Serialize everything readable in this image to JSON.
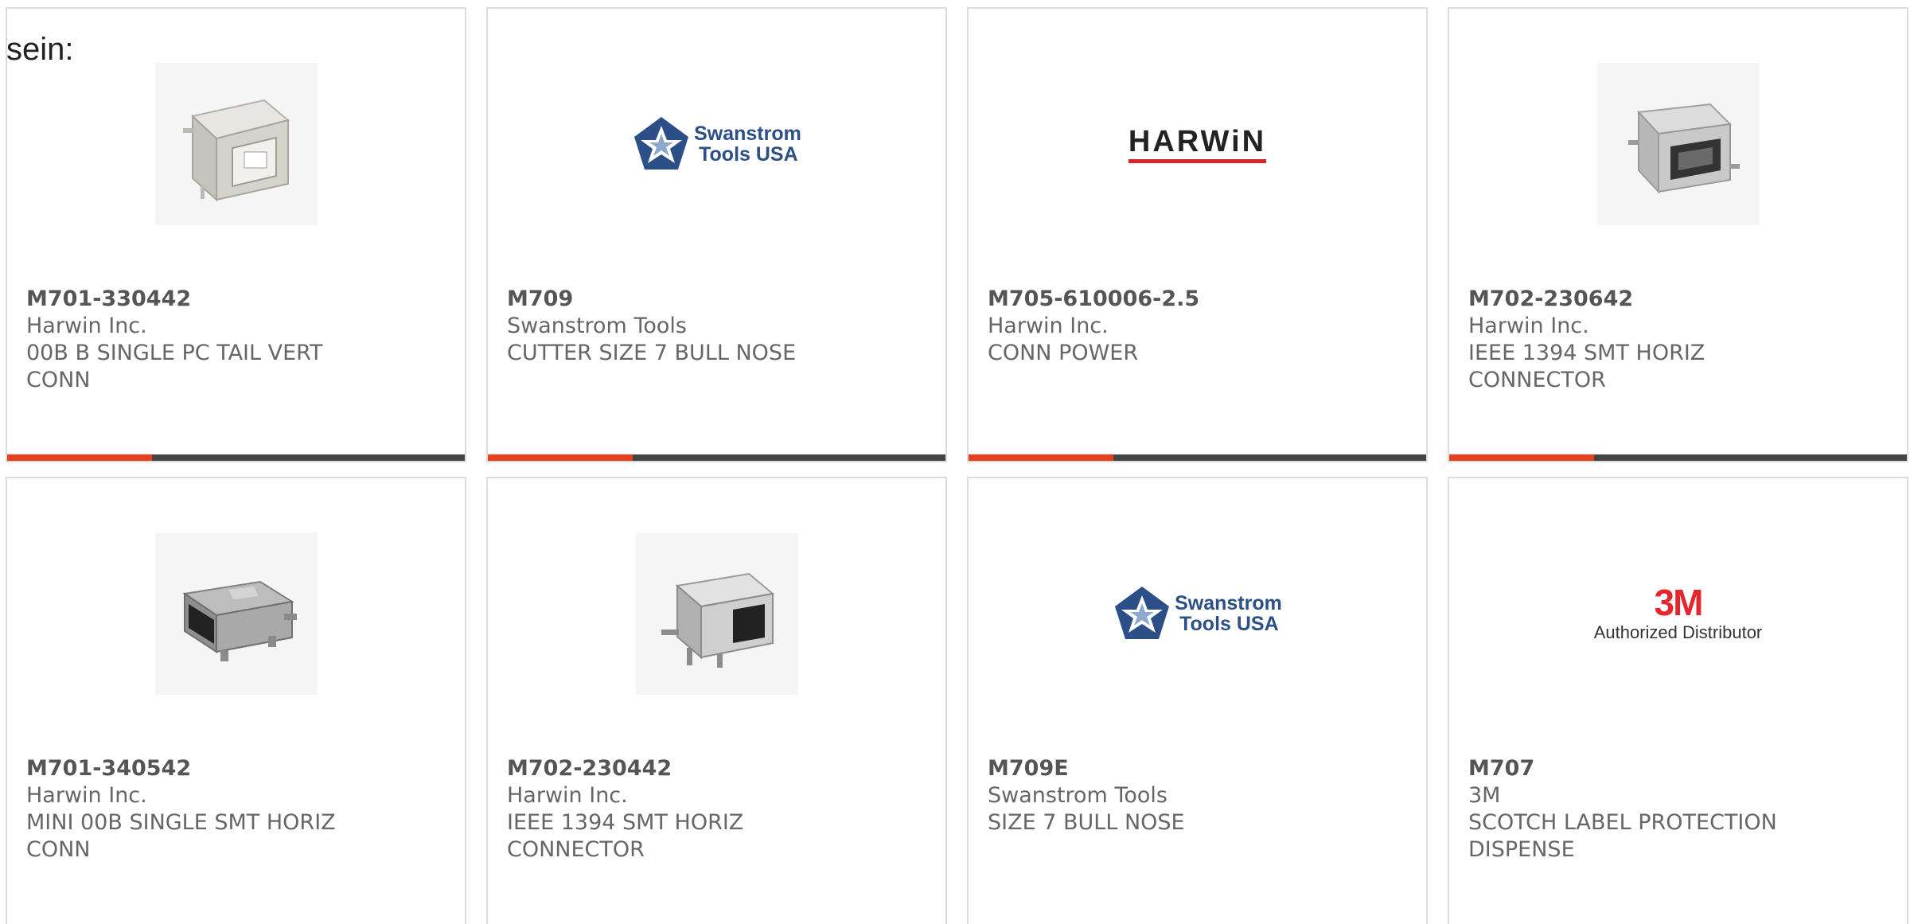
{
  "intro": {
    "text": "sein:"
  },
  "colors": {
    "accent": "#e8401c",
    "bar": "#444444",
    "text": "#666666"
  },
  "products": [
    {
      "part_number": "M701-330442",
      "manufacturer": "Harwin Inc.",
      "description_line1": "00B B SINGLE PC TAIL VERT",
      "description_line2": "CONN",
      "image": "usb-b-connector-photo"
    },
    {
      "part_number": "M709",
      "manufacturer": "Swanstrom Tools",
      "description_line1": "CUTTER SIZE 7 BULL NOSE",
      "description_line2": "",
      "image": "swanstrom-logo"
    },
    {
      "part_number": "M705-610006-2.5",
      "manufacturer": "Harwin Inc.",
      "description_line1": "CONN POWER",
      "description_line2": "",
      "image": "harwin-logo"
    },
    {
      "part_number": "M702-230642",
      "manufacturer": "Harwin Inc.",
      "description_line1": "IEEE 1394 SMT HORIZ",
      "description_line2": "CONNECTOR",
      "image": "ieee1394-connector-photo"
    },
    {
      "part_number": "M701-340542",
      "manufacturer": "Harwin Inc.",
      "description_line1": "MINI 00B SINGLE SMT HORIZ",
      "description_line2": "CONN",
      "image": "mini-usb-connector-photo"
    },
    {
      "part_number": "M702-230442",
      "manufacturer": "Harwin Inc.",
      "description_line1": "IEEE 1394 SMT HORIZ",
      "description_line2": "CONNECTOR",
      "image": "ieee1394-connector-photo"
    },
    {
      "part_number": "M709E",
      "manufacturer": "Swanstrom Tools",
      "description_line1": "SIZE 7 BULL NOSE",
      "description_line2": "",
      "image": "swanstrom-logo"
    },
    {
      "part_number": "M707",
      "manufacturer": "3M",
      "description_line1": "SCOTCH LABEL PROTECTION",
      "description_line2": "DISPENSE",
      "image": "3m-logo"
    }
  ],
  "logos": {
    "swanstrom_line1": "Swanstrom",
    "swanstrom_line2": "Tools USA",
    "harwin": "HARWiN",
    "three_m_mark": "3M",
    "three_m_sub": "Authorized Distributor"
  }
}
